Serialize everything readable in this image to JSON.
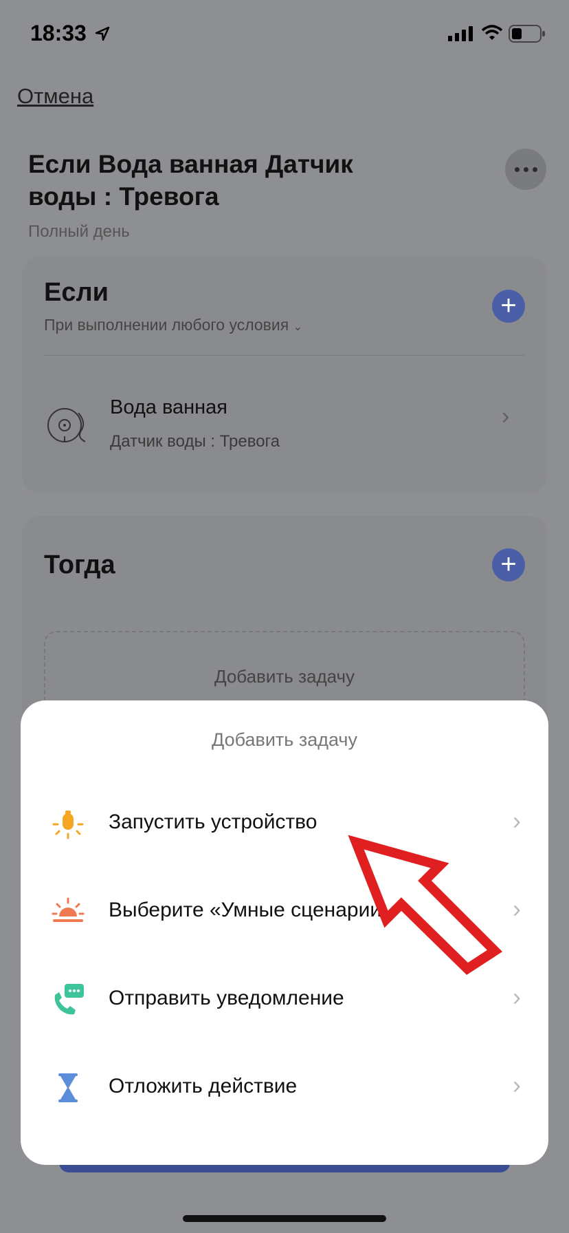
{
  "status_bar": {
    "time": "18:33"
  },
  "header": {
    "cancel_label": "Отмена",
    "title": "Если Вода ванная Датчик воды : Тревога",
    "subtitle": "Полный день"
  },
  "if_section": {
    "title": "Если",
    "condition_mode": "При выполнении любого условия",
    "conditions": [
      {
        "device": "Вода ванная",
        "state": "Датчик воды : Тревога"
      }
    ]
  },
  "then_section": {
    "title": "Тогда",
    "add_task_label": "Добавить задачу"
  },
  "sheet": {
    "title": "Добавить задачу",
    "items": [
      {
        "label": "Запустить устройство",
        "icon": "bulb-icon",
        "color": "#f5a623"
      },
      {
        "label": "Выберите «Умные сценарии»",
        "icon": "sunrise-icon",
        "color": "#ef7a52"
      },
      {
        "label": "Отправить уведомление",
        "icon": "phone-message-icon",
        "color": "#3ec49a"
      },
      {
        "label": "Отложить действие",
        "icon": "hourglass-icon",
        "color": "#5b8dd9"
      }
    ]
  },
  "colors": {
    "accent": "#4a5fa8",
    "annotation_arrow": "#e02020"
  }
}
